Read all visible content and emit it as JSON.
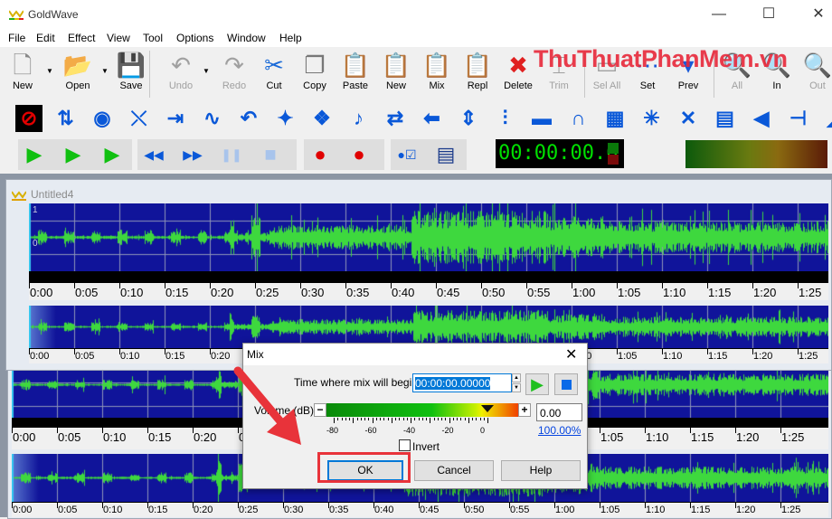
{
  "app": {
    "title": "GoldWave",
    "watermark": "ThuThuatPhanMem.vn"
  },
  "window_controls": {
    "minimize": "—",
    "maximize": "☐",
    "close": "✕"
  },
  "menu": [
    "File",
    "Edit",
    "Effect",
    "View",
    "Tool",
    "Options",
    "Window",
    "Help"
  ],
  "toolbar_main": [
    {
      "label": "New",
      "icon": "new-file-icon",
      "glyph": "🗋",
      "enabled": true
    },
    {
      "label": "Open",
      "icon": "folder-open-icon",
      "glyph": "📂",
      "enabled": true
    },
    {
      "label": "Save",
      "icon": "floppy-disk-icon",
      "glyph": "💾",
      "enabled": true
    },
    {
      "label": "Undo",
      "icon": "undo-icon",
      "glyph": "↶",
      "enabled": false
    },
    {
      "label": "Redo",
      "icon": "redo-icon",
      "glyph": "↷",
      "enabled": false
    },
    {
      "label": "Cut",
      "icon": "scissors-icon",
      "glyph": "✂",
      "enabled": true
    },
    {
      "label": "Copy",
      "icon": "copy-icon",
      "glyph": "❐",
      "enabled": true
    },
    {
      "label": "Paste",
      "icon": "paste-icon",
      "glyph": "📋",
      "enabled": true
    },
    {
      "label": "New",
      "icon": "paste-new-icon",
      "glyph": "📋",
      "enabled": true
    },
    {
      "label": "Mix",
      "icon": "paste-mix-icon",
      "glyph": "📋",
      "enabled": true
    },
    {
      "label": "Repl",
      "icon": "replace-icon",
      "glyph": "📋",
      "enabled": true
    },
    {
      "label": "Delete",
      "icon": "delete-x-icon",
      "glyph": "✖",
      "enabled": true
    },
    {
      "label": "Trim",
      "icon": "trim-icon",
      "glyph": "⌶",
      "enabled": false
    },
    {
      "label": "Sel All",
      "icon": "select-all-icon",
      "glyph": "▭",
      "enabled": false
    },
    {
      "label": "Set",
      "icon": "set-marker-icon",
      "glyph": "⋯",
      "enabled": true
    },
    {
      "label": "Prev",
      "icon": "previous-icon",
      "glyph": "▾",
      "enabled": true
    },
    {
      "label": "All",
      "icon": "zoom-all-icon",
      "glyph": "🔍",
      "enabled": false
    },
    {
      "label": "In",
      "icon": "zoom-in-icon",
      "glyph": "🔍",
      "enabled": true
    },
    {
      "label": "Out",
      "icon": "zoom-out-icon",
      "glyph": "🔍",
      "enabled": false
    }
  ],
  "toolbar_effects": [
    {
      "icon": "no-sign-icon",
      "glyph": "⊘"
    },
    {
      "icon": "compress-expand-icon",
      "glyph": "⇅"
    },
    {
      "icon": "doppler-icon",
      "glyph": "◉"
    },
    {
      "icon": "dynamics-icon",
      "glyph": "⤬"
    },
    {
      "icon": "echo-icon",
      "glyph": "⇥"
    },
    {
      "icon": "waveform-icon",
      "glyph": "∿"
    },
    {
      "icon": "flanger-icon",
      "glyph": "↶"
    },
    {
      "icon": "equalizer-star-icon",
      "glyph": "✦"
    },
    {
      "icon": "mechanize-icon",
      "glyph": "❖"
    },
    {
      "icon": "pitch-icon",
      "glyph": "♪"
    },
    {
      "icon": "reverse-icon",
      "glyph": "⇄"
    },
    {
      "icon": "arrow-left-icon",
      "glyph": "⬅"
    },
    {
      "icon": "resize-icon",
      "glyph": "⇕"
    },
    {
      "icon": "sliders-icon",
      "glyph": "⫶"
    },
    {
      "icon": "spectrum-filter-icon",
      "glyph": "▬"
    },
    {
      "icon": "arch-icon",
      "glyph": "∩"
    },
    {
      "icon": "spectrum-icon",
      "glyph": "▦"
    },
    {
      "icon": "noise-reduction-icon",
      "glyph": "✳"
    },
    {
      "icon": "pop-click-icon",
      "glyph": "✕"
    },
    {
      "icon": "rainbow-icon",
      "glyph": "▤"
    },
    {
      "icon": "volume-icon",
      "glyph": "◀"
    },
    {
      "icon": "volume-slider-icon",
      "glyph": "⊣"
    },
    {
      "icon": "volume-shape-icon",
      "glyph": "◢"
    }
  ],
  "transport": {
    "groups": [
      [
        {
          "icon": "play-icon",
          "glyph": "▶",
          "color": "#10c010"
        },
        {
          "icon": "play-selection-icon",
          "glyph": "▶",
          "color": "#10c010"
        },
        {
          "icon": "play-to-end-icon",
          "glyph": "▶",
          "color": "#10c010"
        }
      ],
      [
        {
          "icon": "rewind-icon",
          "glyph": "◀◀",
          "color": "#0a58d8"
        },
        {
          "icon": "fast-forward-icon",
          "glyph": "▶▶",
          "color": "#0a58d8"
        },
        {
          "icon": "pause-icon",
          "glyph": "❚❚",
          "color": "#a8c4ec"
        },
        {
          "icon": "stop-icon",
          "glyph": "■",
          "color": "#a8c4ec"
        }
      ],
      [
        {
          "icon": "record-icon",
          "glyph": "●",
          "color": "#e00000"
        },
        {
          "icon": "record-selection-icon",
          "glyph": "●",
          "color": "#e00000"
        }
      ],
      [
        {
          "icon": "control-properties-icon",
          "glyph": "●☑",
          "color": "#0a58d8"
        },
        {
          "icon": "device-window-icon",
          "glyph": "▤",
          "color": "#1a3a8a"
        }
      ]
    ],
    "time": "00:00:00.0"
  },
  "document": {
    "title": "Untitled4",
    "amp_top": "1",
    "amp_zero": "0"
  },
  "timeline": [
    "0:00",
    "0:05",
    "0:10",
    "0:15",
    "0:20",
    "0:25",
    "0:30",
    "0:35",
    "0:40",
    "0:45",
    "0:50",
    "0:55",
    "1:00",
    "1:05",
    "1:10",
    "1:15",
    "1:20",
    "1:25"
  ],
  "dialog": {
    "title": "Mix",
    "close": "✕",
    "time_label": "Time where mix will begin:",
    "time_value": "00:00:00.00000",
    "volume_label": "Volume (dB):",
    "volume_value": "0.00",
    "volume_percent": "100.00%",
    "volume_db": 0,
    "scale": [
      "-80",
      "-60",
      "-40",
      "-20",
      "0"
    ],
    "minus": "−",
    "plus": "+",
    "invert_label": "Invert",
    "invert_checked": false,
    "ok": "OK",
    "cancel": "Cancel",
    "help": "Help"
  },
  "colors": {
    "wave_bg": "#10149a",
    "wave": "#3ed83e",
    "highlight": "#e8333a"
  }
}
